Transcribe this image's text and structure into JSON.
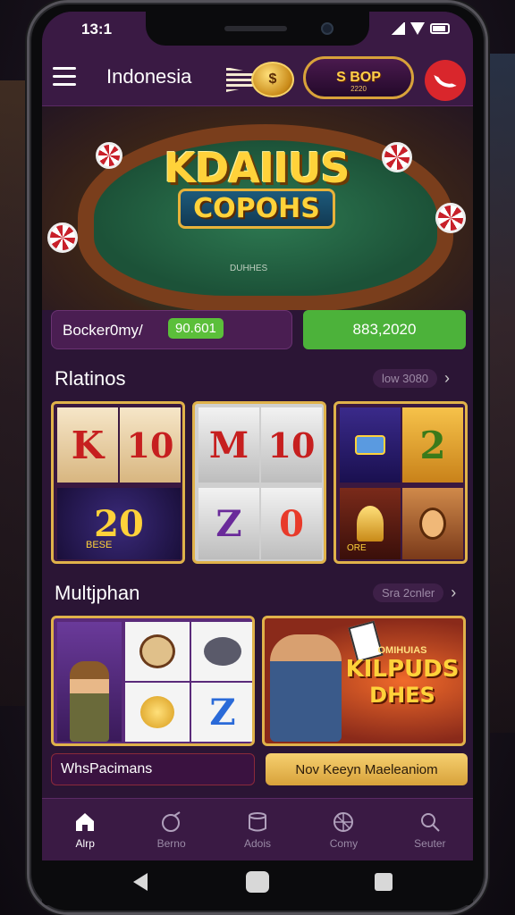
{
  "status": {
    "time": "13:1"
  },
  "header": {
    "region": "Indonesia",
    "brand_text": "S BOP",
    "brand_sub": "2220"
  },
  "hero": {
    "title_line1": "KDAIIUS",
    "title_line2": "COPOHS",
    "subtitle": "DUHHES"
  },
  "balance": {
    "label": "Bocker0my/",
    "value": "90.601",
    "button_label": "883,2020"
  },
  "section1": {
    "title": "Rlatinos",
    "see_all": "low 3080",
    "tiles": {
      "a1": "K",
      "a2": "10",
      "a3": "20",
      "a3_label": "BESE",
      "b1": "M",
      "b2": "10",
      "b3": "Z",
      "b4": "0",
      "c2": "2",
      "c3_label": "ORE"
    }
  },
  "section2": {
    "title": "Multjphan",
    "see_all": "Sra 2cnler",
    "tiles": {
      "a4": "Z"
    },
    "banner_line1": "OMIHUIAS",
    "banner_line2": "KILPUDS",
    "banner_line3": "DHES",
    "btn_left": "WhsPacimans",
    "btn_right": "Nov Keeyn  Maeleaniom"
  },
  "nav": [
    {
      "label": "Alrp",
      "icon": "home-icon"
    },
    {
      "label": "Berno",
      "icon": "ball-icon"
    },
    {
      "label": "Adois",
      "icon": "cup-icon"
    },
    {
      "label": "Comy",
      "icon": "globe-icon"
    },
    {
      "label": "Seuter",
      "icon": "search-icon"
    }
  ],
  "colors": {
    "accent_gold": "#e0b24a",
    "purple_bg": "#2b1535",
    "green": "#4cb23a",
    "call_red": "#d9262c"
  }
}
